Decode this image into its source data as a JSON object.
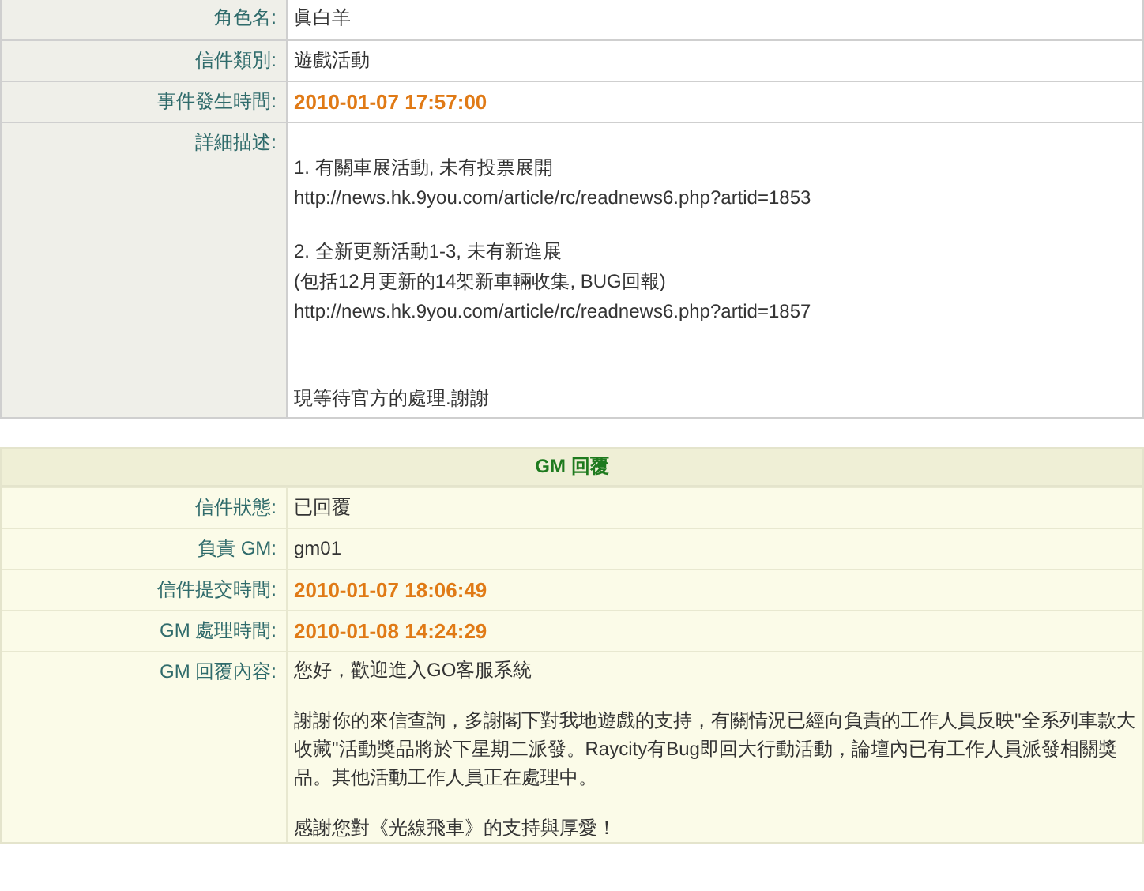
{
  "ticket": {
    "rows": [
      {
        "label": "角色名:",
        "kind": "text",
        "value": "眞白羊"
      },
      {
        "label": "信件類別:",
        "kind": "text",
        "value": "遊戲活動"
      },
      {
        "label": "事件發生時間:",
        "kind": "time",
        "value": "2010-01-07 17:57:00"
      },
      {
        "label": "詳細描述:",
        "kind": "paragraphs",
        "paragraphs": [
          [
            "1. 有關車展活動, 未有投票展開",
            "http://news.hk.9you.com/article/rc/readnews6.php?artid=1853"
          ],
          [
            "2. 全新更新活動1-3, 未有新進展",
            "(包括12月更新的14架新車輛收集, BUG回報)",
            "http://news.hk.9you.com/article/rc/readnews6.php?artid=1857"
          ],
          [
            "現等待官方的處理.謝謝"
          ]
        ]
      }
    ]
  },
  "gm_reply": {
    "title": "GM 回覆",
    "rows": [
      {
        "label": "信件狀態:",
        "kind": "text",
        "value": "已回覆"
      },
      {
        "label": "負責 GM:",
        "kind": "text",
        "value": "gm01"
      },
      {
        "label": "信件提交時間:",
        "kind": "time",
        "value": "2010-01-07 18:06:49"
      },
      {
        "label": "GM 處理時間:",
        "kind": "time",
        "value": "2010-01-08 14:24:29"
      },
      {
        "label": "GM 回覆內容:",
        "kind": "paragraphs",
        "paragraphs": [
          [
            "您好，歡迎進入GO客服系統"
          ],
          [
            "謝謝你的來信查詢，多謝閣下對我地遊戲的支持，有關情況已經向負責的工作人員反映\"全系列車款大收藏\"活動獎品將於下星期二派發。Raycity有Bug即回大行動活動，論壇內已有工作人員派發相關獎品。其他活動工作人員正在處理中。"
          ],
          [
            "感謝您對《光線飛車》的支持與厚愛！"
          ]
        ]
      }
    ]
  }
}
